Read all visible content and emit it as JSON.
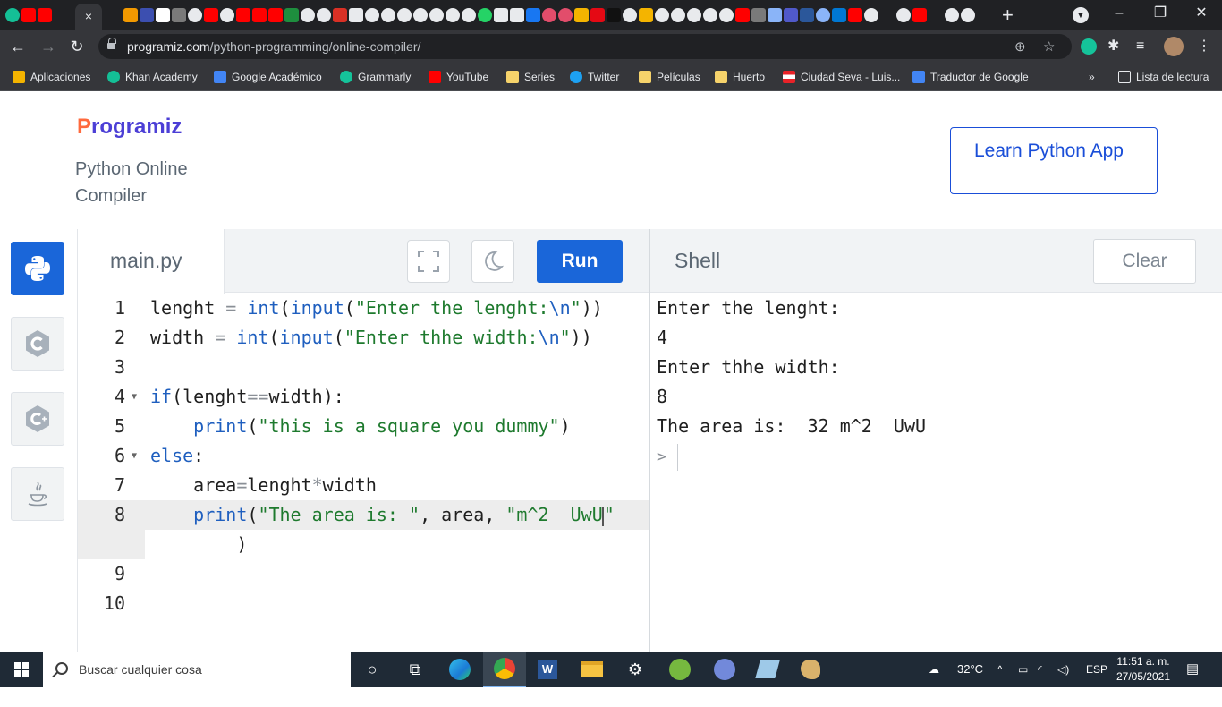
{
  "browser": {
    "active_tab_close": "×",
    "new_tab": "+",
    "url_domain": "programiz.com",
    "url_path": "/python-programming/online-compiler/",
    "window_controls": {
      "minimize": "–",
      "restore": "❐",
      "close": "✕"
    },
    "bookmarks": [
      {
        "label": "Aplicaciones",
        "icon": "apps-grid-icon",
        "color": "#f4b400"
      },
      {
        "label": "Khan Academy",
        "icon": "khan-academy-icon",
        "color": "#14bf96"
      },
      {
        "label": "Google Académico",
        "icon": "scholar-icon",
        "color": "#4285f4"
      },
      {
        "label": "Grammarly",
        "icon": "grammarly-icon",
        "color": "#15c39a"
      },
      {
        "label": "YouTube",
        "icon": "youtube-icon",
        "color": "#ff0000"
      },
      {
        "label": "Series",
        "icon": "folder-icon",
        "color": "#f6d36b"
      },
      {
        "label": "Twitter",
        "icon": "twitter-icon",
        "color": "#1da1f2"
      },
      {
        "label": "Películas",
        "icon": "folder-icon",
        "color": "#f6d36b"
      },
      {
        "label": "Huerto",
        "icon": "folder-icon",
        "color": "#f6d36b"
      },
      {
        "label": "Ciudad Seva - Luis...",
        "icon": "puerto-rico-flag-icon",
        "color": "#e92228"
      },
      {
        "label": "Traductor de Google",
        "icon": "google-translate-icon",
        "color": "#4285f4"
      }
    ],
    "bookmarks_overflow": "»",
    "reading_list": "Lista de lectura"
  },
  "header": {
    "logo_first": "P",
    "logo_rest": "rogramiz",
    "subtitle": "Python Online Compiler",
    "learn_button": "Learn Python App"
  },
  "languages": [
    {
      "name": "python",
      "active": true
    },
    {
      "name": "c",
      "active": false
    },
    {
      "name": "cpp",
      "active": false
    },
    {
      "name": "java",
      "active": false
    }
  ],
  "editor": {
    "filename": "main.py",
    "run_label": "Run",
    "line_numbers": [
      "1",
      "2",
      "3",
      "4",
      "5",
      "6",
      "7",
      "8",
      "9",
      "10"
    ],
    "lines": [
      "lenght = int(input(\"Enter the lenght:\\n\"))",
      "width = int(input(\"Enter thhe width:\\n\"))",
      "",
      "if(lenght==width):",
      "    print(\"this is a square you dummy\")",
      "else:",
      "    area=lenght*width",
      "    print(\"The area is: \", area, \"m^2  UwU\"",
      "        )",
      "",
      ""
    ]
  },
  "shell": {
    "title": "Shell",
    "clear_label": "Clear",
    "output": [
      "Enter the lenght:",
      "4",
      "Enter thhe width:",
      "8",
      "The area is:  32 m^2  UwU"
    ],
    "prompt": ">"
  },
  "taskbar": {
    "search_placeholder": "Buscar cualquier cosa",
    "temperature": "32°C",
    "language": "ESP",
    "time": "11:51 a. m.",
    "date": "27/05/2021"
  },
  "colors": {
    "brand_blue": "#1a66d9",
    "logo_purple": "#4c3fd6",
    "logo_orange": "#ff6a3d"
  }
}
